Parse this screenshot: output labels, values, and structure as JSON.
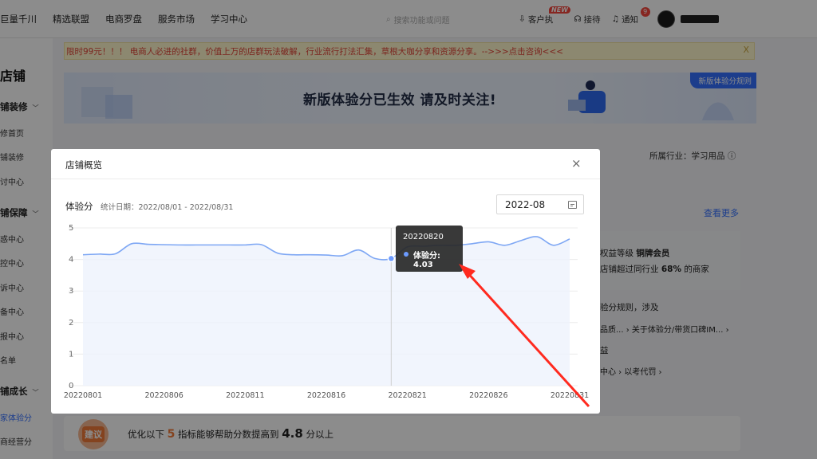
{
  "topnav": {
    "items": [
      "巨量千川",
      "精选联盟",
      "电商罗盘",
      "服务市场",
      "学习中心"
    ],
    "search_placeholder": "搜索功能或问题",
    "customer_label": "客户执",
    "customer_badge": "NEW",
    "reception_label": "接待",
    "notify_label": "通知",
    "notify_count": "9"
  },
  "sidebar": {
    "title": "店铺",
    "groups": [
      "铺装修",
      "铺保障",
      "铺成长"
    ],
    "decor_items": [
      "修首页",
      "铺装修",
      "讨中心"
    ],
    "guard_items": [
      "惑中心",
      "控中心",
      "诉中心",
      "备中心",
      "报中心",
      "名单"
    ],
    "growth_items": [
      "家体验分",
      "商经营分"
    ]
  },
  "notice": {
    "text": "限时99元！！！ 电商人必进的社群，价值上万的店群玩法破解，行业流行打法汇集，草根大咖分享和资源分享。-->>>点击咨询<<<",
    "close": "X"
  },
  "banner": {
    "title": "新版体验分已生效 请及时关注!",
    "rule_link": "新版体验分规则"
  },
  "background": {
    "industry": "所属行业：学习用品",
    "view_more": "查看更多",
    "rights_prefix": "权益等级 ",
    "rights_level": "铜牌会员",
    "beat_text_a": "店铺超过同行业 ",
    "beat_pct": "68%",
    "beat_text_b": " 的商家",
    "rule_text": "验分规则，涉及",
    "link_a": "品质...",
    "link_b": "关于体验分/带货口碑IM...",
    "group_c": "益",
    "link_c": "中心",
    "link_d": "以考代罚",
    "suggest_badge": "建议",
    "suggest_a": "优化以下 ",
    "suggest_num": "5",
    "suggest_b": " 指标能够帮助分数提高到 ",
    "suggest_score": "4.8",
    "suggest_c": " 分以上"
  },
  "modal": {
    "title": "店铺概览",
    "close": "×",
    "metric_label": "体验分",
    "date_range": "统计日期：2022/08/01 - 2022/08/31",
    "month_value": "2022-08",
    "tooltip_date": "20220820",
    "tooltip_value": "体验分: 4.03"
  },
  "colors": {
    "accent": "#3470ff",
    "line": "#7ea7f4",
    "notice_text": "#e0453a",
    "annotation_arrow": "#ff2a1f"
  },
  "chart_data": {
    "type": "line",
    "title": "",
    "xlabel": "",
    "ylabel": "",
    "ylim": [
      0,
      5
    ],
    "yticks": [
      0,
      1,
      2,
      3,
      4,
      5
    ],
    "x": [
      "20220801",
      "20220802",
      "20220803",
      "20220804",
      "20220805",
      "20220806",
      "20220807",
      "20220808",
      "20220809",
      "20220810",
      "20220811",
      "20220812",
      "20220813",
      "20220814",
      "20220815",
      "20220816",
      "20220817",
      "20220818",
      "20220819",
      "20220820",
      "20220821",
      "20220822",
      "20220823",
      "20220824",
      "20220825",
      "20220826",
      "20220827",
      "20220828",
      "20220829",
      "20220830",
      "20220831"
    ],
    "xtick_labels": [
      "20220801",
      "20220806",
      "20220811",
      "20220816",
      "20220821",
      "20220826",
      "20220831"
    ],
    "series": [
      {
        "name": "体验分",
        "values": [
          4.15,
          4.17,
          4.18,
          4.5,
          4.48,
          4.47,
          4.46,
          4.46,
          4.46,
          4.46,
          4.46,
          4.47,
          4.2,
          4.15,
          4.15,
          4.14,
          4.12,
          4.3,
          4.03,
          4.03,
          4.4,
          4.42,
          4.45,
          4.45,
          4.5,
          4.56,
          4.45,
          4.6,
          4.72,
          4.45,
          4.65
        ]
      }
    ],
    "highlight_index": 19,
    "grid": true,
    "legend": "none"
  }
}
